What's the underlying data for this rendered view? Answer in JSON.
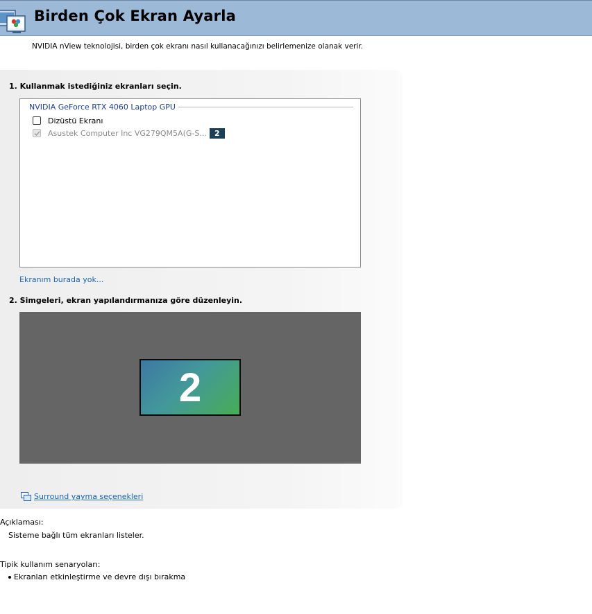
{
  "header": {
    "title": "Birden Çok Ekran Ayarla",
    "icon": "multi-display-icon"
  },
  "subtitle": "NVIDIA nView teknolojisi, birden çok ekranı nasıl kullanacağınızı belirlemenize olanak verir.",
  "step1": {
    "label": "1. Kullanmak istediğiniz ekranları seçin.",
    "gpu_name": "NVIDIA GeForce RTX 4060 Laptop GPU",
    "displays": [
      {
        "label": "Dizüstü Ekranı",
        "checked": false,
        "enabled": true
      },
      {
        "label": "Asustek Computer Inc VG279QM5A(G-S...",
        "checked": true,
        "enabled": false,
        "badge": "2"
      }
    ],
    "missing_link": "Ekranım burada yok..."
  },
  "step2": {
    "label": "2. Simgeleri, ekran yapılandırmanıza göre düzenleyin.",
    "monitor_number": "2"
  },
  "surround_link": "Surround yayma seçenekleri",
  "description": {
    "heading": "Açıklaması:",
    "text": "Sisteme bağlı tüm ekranları listeler."
  },
  "scenarios": {
    "heading": "Tipik kullanım senaryoları:",
    "items": [
      "Ekranları etkinleştirme ve devre dışı bırakma"
    ]
  },
  "colors": {
    "header_bg": "#9db9d8",
    "link": "#1a63b8",
    "badge_bg": "#1c3f58",
    "arrange_bg": "#656565"
  }
}
